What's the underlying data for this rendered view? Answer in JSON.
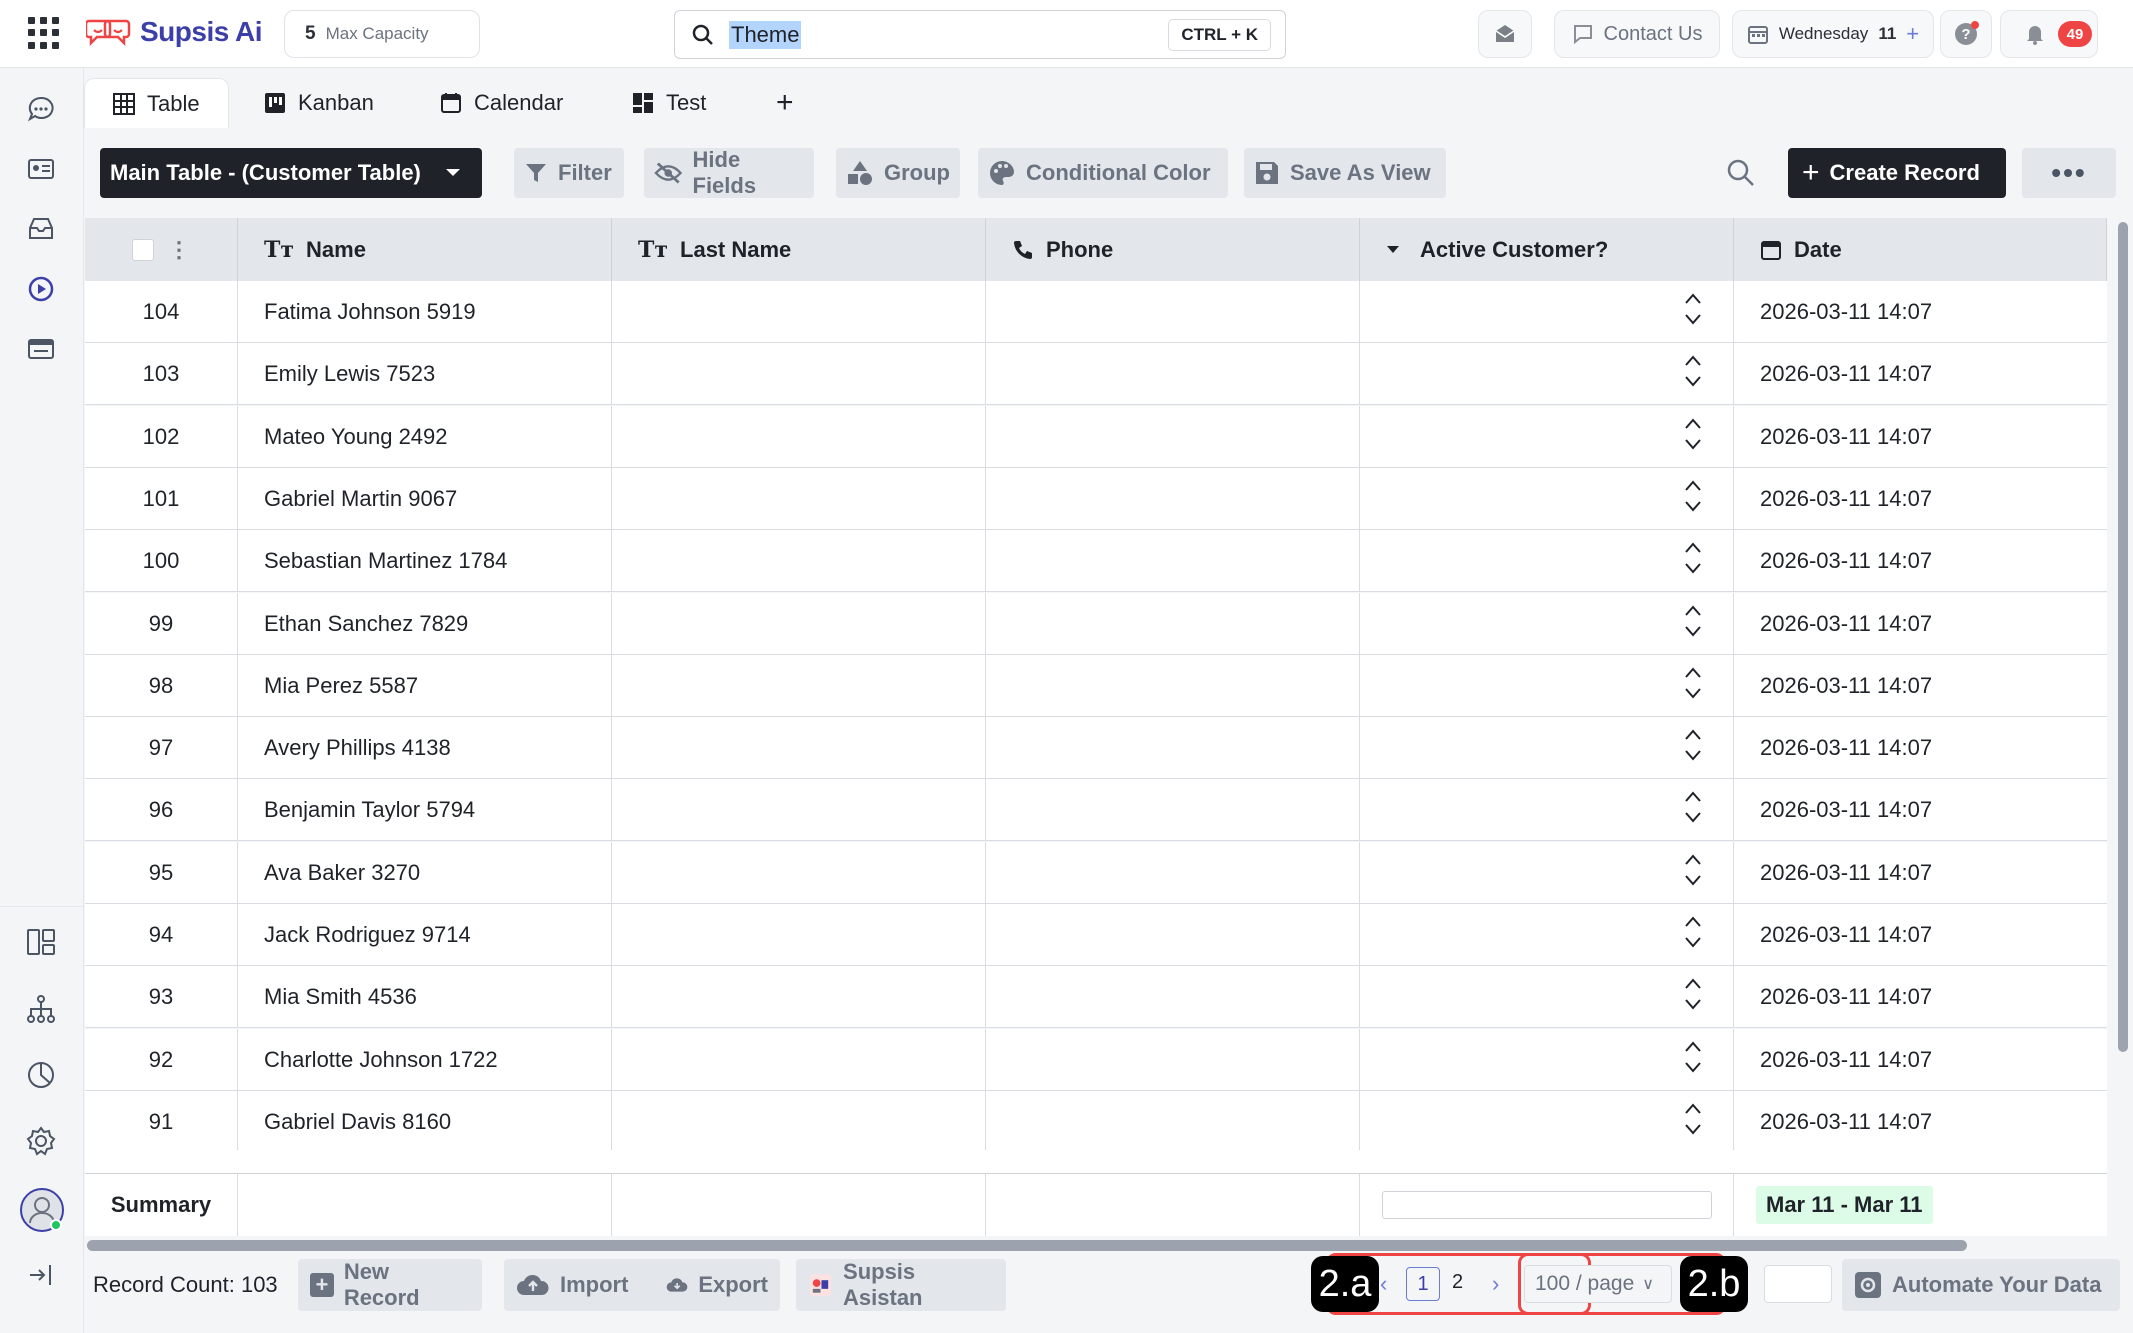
{
  "topbar": {
    "brand": "Supsis Ai",
    "capacity_number": "5",
    "capacity_label": "Max Capacity",
    "search_value": "Theme",
    "search_shortcut": "CTRL + K",
    "contact_label": "Contact Us",
    "day_label": "Wednesday",
    "day_number": "11",
    "notification_count": "49"
  },
  "tabs": [
    {
      "label": "Table",
      "icon": "table-icon",
      "active": true
    },
    {
      "label": "Kanban",
      "icon": "kanban-icon",
      "active": false
    },
    {
      "label": "Calendar",
      "icon": "calendar-icon",
      "active": false
    },
    {
      "label": "Test",
      "icon": "dashboard-icon",
      "active": false
    }
  ],
  "toolbar": {
    "table_select": "Main Table - (Customer Table)",
    "filter": "Filter",
    "hide_fields": "Hide Fields",
    "group": "Group",
    "conditional_color": "Conditional Color",
    "save_as_view": "Save As View",
    "create_record": "Create Record"
  },
  "table": {
    "columns": [
      "Name",
      "Last Name",
      "Phone",
      "Active Customer?",
      "Date"
    ],
    "rows": [
      {
        "id": "104",
        "name": "Fatima Johnson 5919",
        "date": "2026-03-11 14:07"
      },
      {
        "id": "103",
        "name": "Emily Lewis 7523",
        "date": "2026-03-11 14:07"
      },
      {
        "id": "102",
        "name": "Mateo Young 2492",
        "date": "2026-03-11 14:07"
      },
      {
        "id": "101",
        "name": "Gabriel Martin 9067",
        "date": "2026-03-11 14:07"
      },
      {
        "id": "100",
        "name": "Sebastian Martinez 1784",
        "date": "2026-03-11 14:07"
      },
      {
        "id": "99",
        "name": "Ethan Sanchez 7829",
        "date": "2026-03-11 14:07"
      },
      {
        "id": "98",
        "name": "Mia Perez 5587",
        "date": "2026-03-11 14:07"
      },
      {
        "id": "97",
        "name": "Avery Phillips 4138",
        "date": "2026-03-11 14:07"
      },
      {
        "id": "96",
        "name": "Benjamin Taylor 5794",
        "date": "2026-03-11 14:07"
      },
      {
        "id": "95",
        "name": "Ava Baker 3270",
        "date": "2026-03-11 14:07"
      },
      {
        "id": "94",
        "name": "Jack Rodriguez 9714",
        "date": "2026-03-11 14:07"
      },
      {
        "id": "93",
        "name": "Mia Smith 4536",
        "date": "2026-03-11 14:07"
      },
      {
        "id": "92",
        "name": "Charlotte Johnson 1722",
        "date": "2026-03-11 14:07"
      },
      {
        "id": "91",
        "name": "Gabriel Davis 8160",
        "date": "2026-03-11 14:07"
      }
    ],
    "summary_label": "Summary",
    "date_range": "Mar 11 - Mar 11"
  },
  "footer": {
    "record_count": "Record Count: 103",
    "new_record": "New Record",
    "import": "Import",
    "export": "Export",
    "assistant": "Supsis Asistan",
    "pages": [
      "1",
      "2"
    ],
    "current_page": "1",
    "page_size": "100 / page",
    "automate": "Automate Your Data"
  },
  "annotations": {
    "callout_a": "2.a",
    "callout_b": "2.b"
  },
  "colors": {
    "accent_red": "#ef4444",
    "brand_indigo": "#3c3fa8",
    "dark_button": "#1f2329",
    "date_highlight": "#dcfce7"
  }
}
